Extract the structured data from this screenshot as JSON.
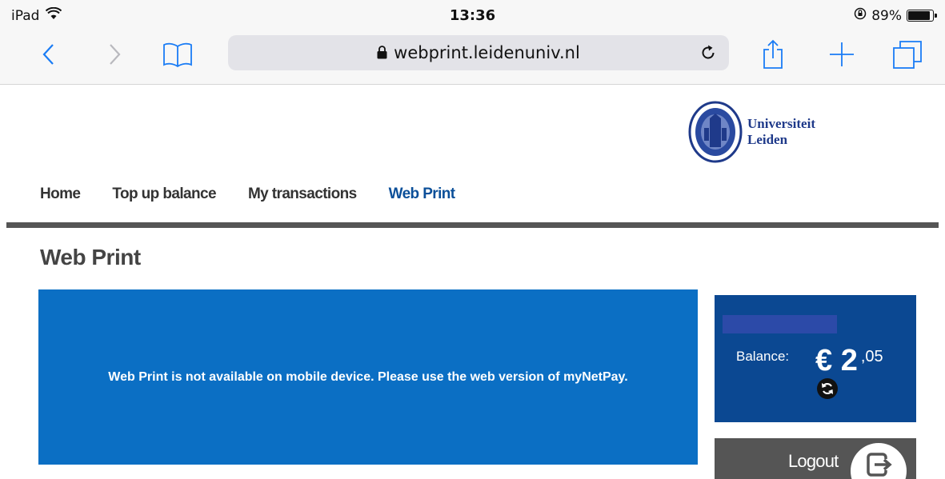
{
  "status_bar": {
    "device": "iPad",
    "time": "13:36",
    "battery": "89%",
    "battery_level": 0.89
  },
  "browser": {
    "url": "webprint.leidenuniv.nl"
  },
  "site": {
    "logo_line1": "Universiteit",
    "logo_line2": "Leiden",
    "nav": [
      {
        "label": "Home",
        "active": false
      },
      {
        "label": "Top up balance",
        "active": false
      },
      {
        "label": "My transactions",
        "active": false
      },
      {
        "label": "Web Print",
        "active": true
      }
    ],
    "page_title": "Web Print",
    "notice": "Web Print is not available on mobile device. Please use the web version of myNetPay.",
    "balance": {
      "label": "Balance:",
      "currency_amount": "€ 2",
      "cents": ",05"
    },
    "logout_label": "Logout"
  },
  "colors": {
    "notice_bg": "#0b6fc4",
    "balance_bg": "#0b4892",
    "active_nav": "#0b4f99",
    "logout_bg": "#555555"
  }
}
